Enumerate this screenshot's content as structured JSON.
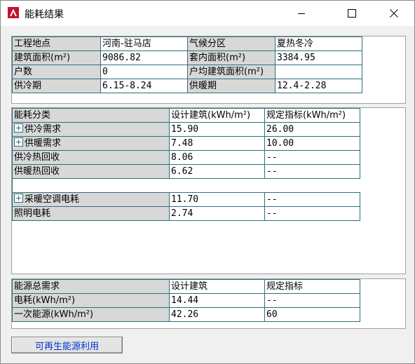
{
  "window": {
    "title": "能耗结果"
  },
  "info": {
    "rows": [
      [
        "工程地点",
        "河南-驻马店",
        "气候分区",
        "夏热冬冷"
      ],
      [
        "建筑面积(m²)",
        "9086.82",
        "套内面积(m²)",
        "3384.95"
      ],
      [
        "户数",
        "0",
        "户均建筑面积(m²)",
        ""
      ],
      [
        "供冷期",
        "6.15-8.24",
        "供暖期",
        "12.4-2.28"
      ]
    ]
  },
  "energy": {
    "headers": [
      "能耗分类",
      "设计建筑(kWh/m²)",
      "规定指标(kWh/m²)"
    ],
    "rows": [
      {
        "label": "供冷需求",
        "design": "15.90",
        "standard": "26.00",
        "expand": true
      },
      {
        "label": "供暖需求",
        "design": "7.48",
        "standard": "10.00",
        "expand": true
      },
      {
        "label": "供冷热回收",
        "design": "8.06",
        "standard": "--",
        "expand": false
      },
      {
        "label": "供暖热回收",
        "design": "6.62",
        "standard": "--",
        "expand": false
      },
      {
        "label": "",
        "design": "",
        "standard": "",
        "expand": false
      },
      {
        "label": "采暖空调电耗",
        "design": "11.70",
        "standard": "--",
        "expand": true
      },
      {
        "label": "照明电耗",
        "design": "2.74",
        "standard": "--",
        "expand": false
      }
    ]
  },
  "total": {
    "headers": [
      "能源总需求",
      "设计建筑",
      "规定指标"
    ],
    "rows": [
      [
        "电耗(kWh/m²)",
        "14.44",
        "--"
      ],
      [
        "一次能源(kWh/m²)",
        "42.26",
        "60"
      ]
    ]
  },
  "buttons": {
    "renewable": "可再生能源利用"
  }
}
